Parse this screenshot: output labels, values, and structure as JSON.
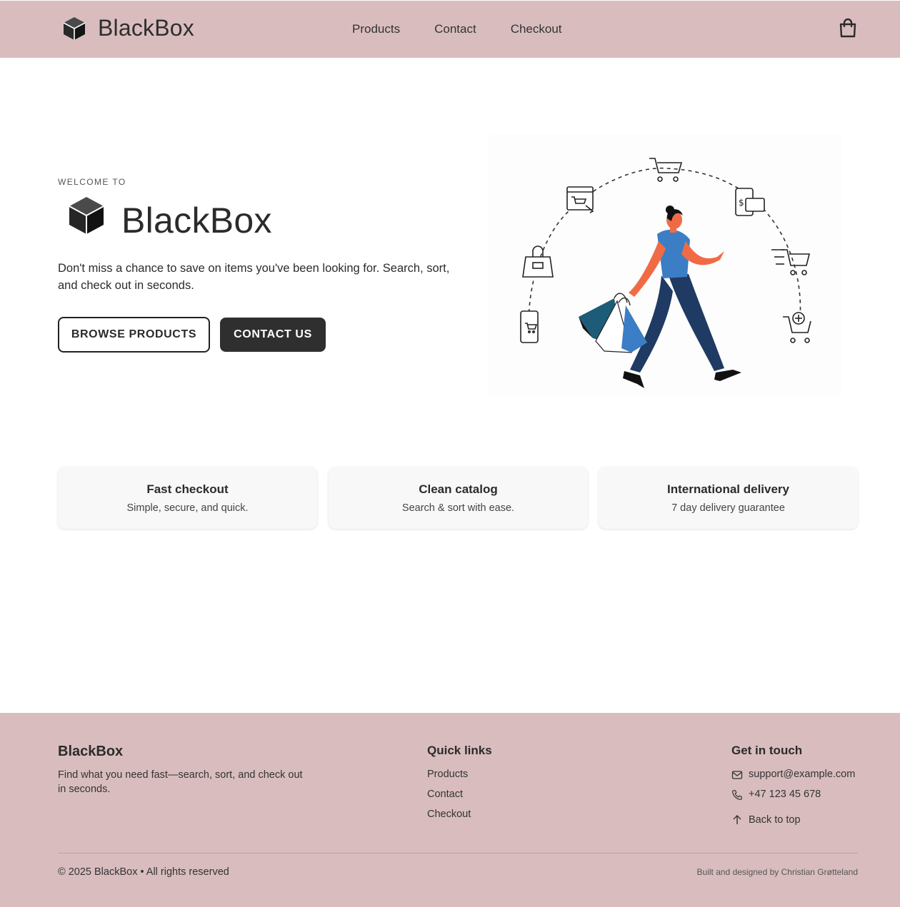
{
  "header": {
    "brand_name": "BlackBox",
    "nav": [
      "Products",
      "Contact",
      "Checkout"
    ]
  },
  "hero": {
    "eyebrow": "WELCOME TO",
    "title": "BlackBox",
    "description": "Don't miss a chance to save on items you've been looking for. Search, sort, and check out in seconds.",
    "primary_button": "BROWSE PRODUCTS",
    "secondary_button": "CONTACT US"
  },
  "features": [
    {
      "title": "Fast checkout",
      "description": "Simple, secure, and quick."
    },
    {
      "title": "Clean catalog",
      "description": "Search & sort with ease."
    },
    {
      "title": "International delivery",
      "description": "7 day delivery guarantee"
    }
  ],
  "footer": {
    "brand": "BlackBox",
    "description": "Find what you need fast—search, sort, and check out in seconds.",
    "quick_links_title": "Quick links",
    "quick_links": [
      "Products",
      "Contact",
      "Checkout"
    ],
    "contact_title": "Get in touch",
    "email": "support@example.com",
    "phone": "+47 123 45 678",
    "back_to_top": "Back to top",
    "copyright": "© 2025 BlackBox • All rights reserved",
    "credit": "Built and designed by Christian Grøtteland"
  },
  "colors": {
    "header_bg": "#d9bdbe",
    "footer_bg": "#d9bdbe",
    "dark_button": "#2f2f2f",
    "illustration_shirt": "#3b7ec5",
    "illustration_pants": "#1f3a63",
    "illustration_skin": "#f06b45"
  },
  "icons": [
    "cube-logo-icon",
    "shopping-bag-icon",
    "mail-icon",
    "phone-icon",
    "arrow-up-icon"
  ]
}
